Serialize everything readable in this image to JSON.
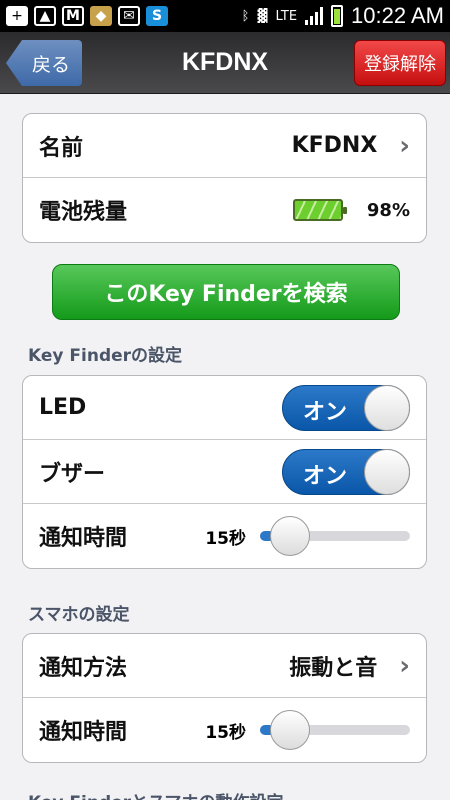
{
  "status_bar": {
    "time": "10:22 AM",
    "network": "LTE",
    "left_icons": [
      "plus-icon",
      "image-icon",
      "gmail-icon",
      "app-icon",
      "mail-icon",
      "skype-icon"
    ]
  },
  "nav": {
    "back_label": "戻る",
    "title": "KFDNX",
    "unregister_label": "登録解除"
  },
  "device": {
    "name_label": "名前",
    "name_value": "KFDNX",
    "battery_label": "電池残量",
    "battery_value": "98%",
    "battery_level": 0.98
  },
  "search_button_label": "このKey Finderを検索",
  "keyfinder_section": {
    "title": "Key Finderの設定",
    "led_label": "LED",
    "led_toggle": "オン",
    "buzzer_label": "ブザー",
    "buzzer_toggle": "オン",
    "notify_time_label": "通知時間",
    "notify_time_value": "15秒",
    "notify_time_level": 0.2
  },
  "phone_section": {
    "title": "スマホの設定",
    "method_label": "通知方法",
    "method_value": "振動と音",
    "notify_time_label": "通知時間",
    "notify_time_value": "15秒",
    "notify_time_level": 0.2
  },
  "next_section_title": "Key Finderとスマホの動作設定",
  "colors": {
    "accent_blue": "#0a57a9",
    "search_green": "#149a1a",
    "unregister_red": "#c50f0f"
  }
}
